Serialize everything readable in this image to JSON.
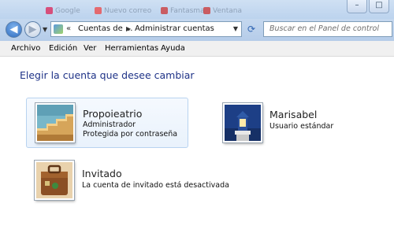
{
  "chrome": {
    "ghost_tabs": [
      "Google",
      "Nuevo correo",
      "Fantasma",
      "Ventana"
    ]
  },
  "nav": {
    "breadcrumb_1": "Cuentas de ...",
    "breadcrumb_2": "Administrar cuentas",
    "search_placeholder": "Buscar en el Panel de control"
  },
  "menu": {
    "items": [
      "Archivo",
      "Edición",
      "Ver",
      "Herramientas",
      "Ayuda"
    ]
  },
  "main": {
    "title": "Elegir la cuenta que desee cambiar",
    "accounts": [
      {
        "name": "Propoieatrio",
        "lines": [
          "Administrador",
          "Protegida por contraseña"
        ],
        "icon": "stairs-avatar-icon",
        "selected": true
      },
      {
        "name": "Marisabel",
        "lines": [
          "Usuario estándar"
        ],
        "icon": "lighthouse-avatar-icon",
        "selected": false
      },
      {
        "name": "Invitado",
        "lines": [
          "La cuenta de invitado está desactivada"
        ],
        "icon": "suitcase-avatar-icon",
        "selected": false
      }
    ]
  },
  "colors": {
    "title_blue": "#1e3287",
    "selected_bg": "#e9f2fc",
    "selected_border": "#b8d3f0"
  }
}
